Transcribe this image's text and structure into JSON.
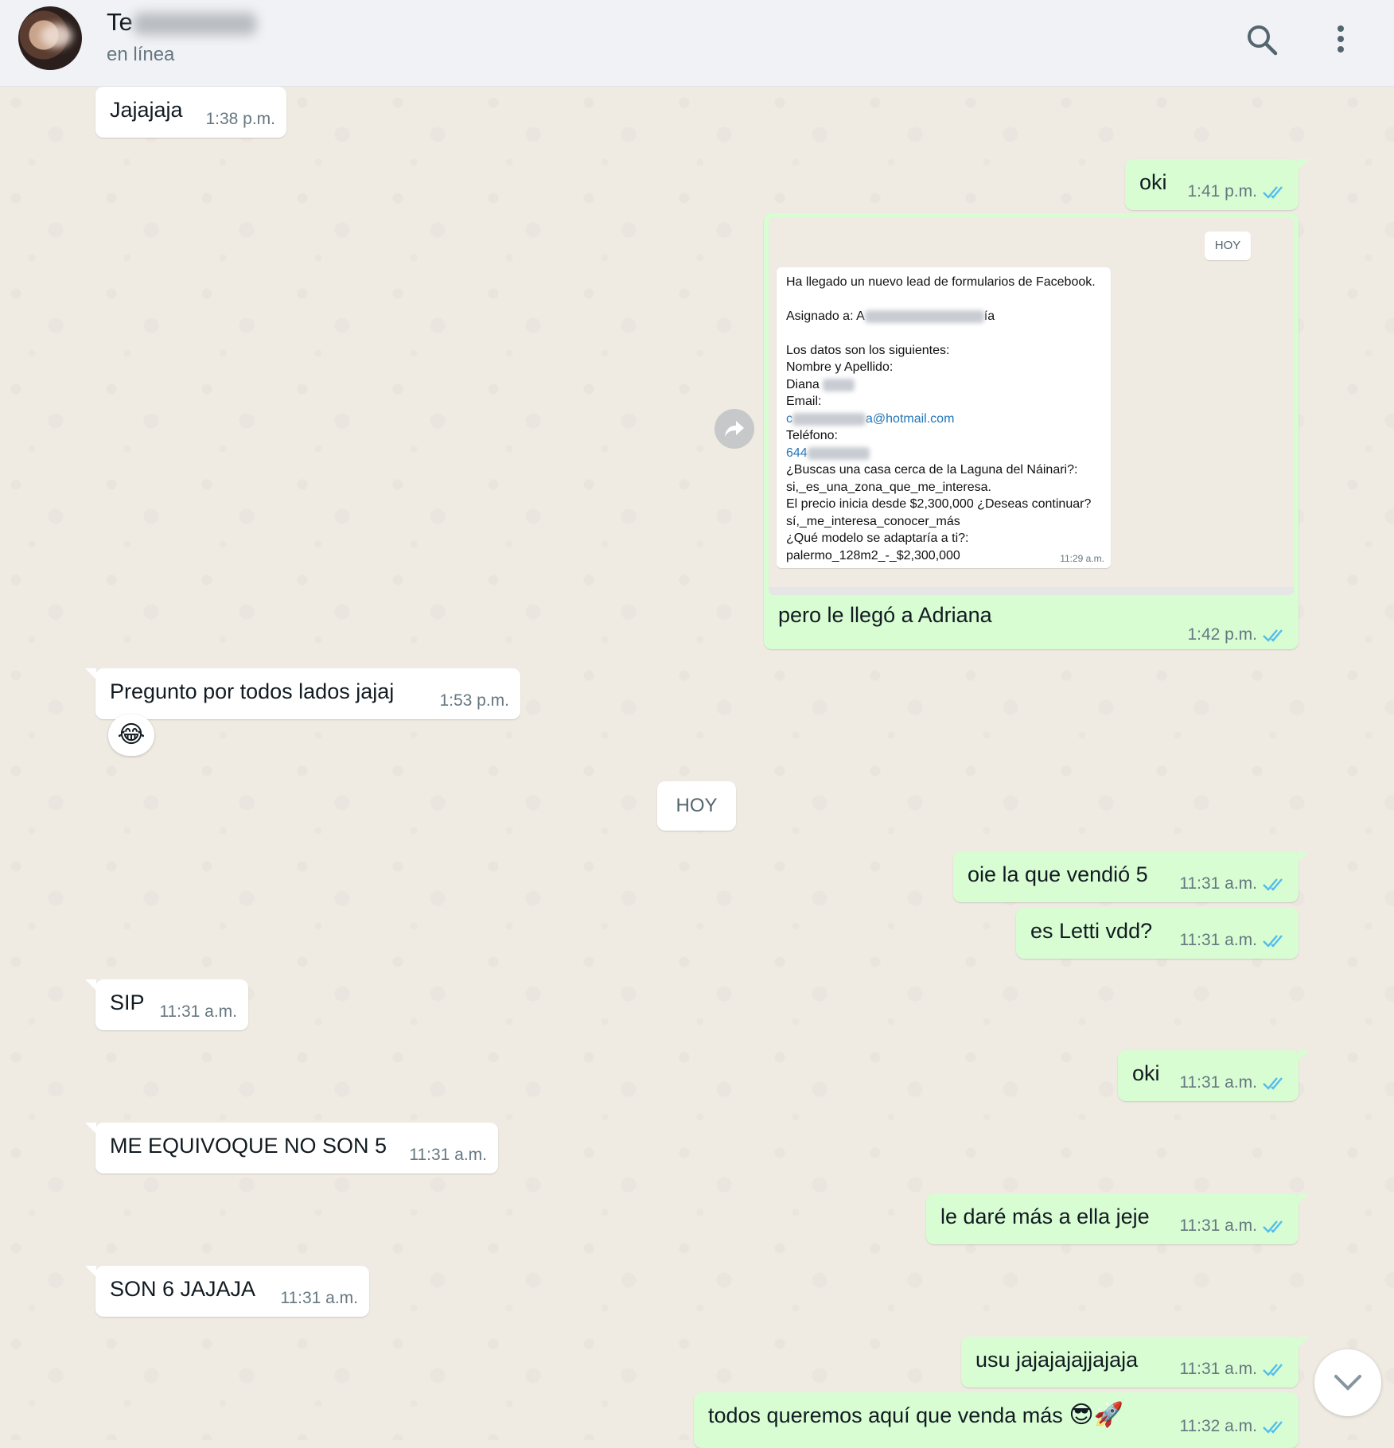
{
  "header": {
    "contact_name": "Te",
    "status": "en línea",
    "icons": [
      "search-icon",
      "more-vert-icon"
    ]
  },
  "colors": {
    "incoming_bubble": "#ffffff",
    "outgoing_bubble": "#d9fdd3",
    "chat_background": "#efeae2",
    "read_ticks": "#53bdeb",
    "header_background": "#f0f2f5"
  },
  "messages": [
    {
      "dir": "in",
      "text": "Jajajaja",
      "time": "1:38 p.m."
    },
    {
      "dir": "out",
      "text": "oki",
      "time": "1:41 p.m."
    },
    {
      "dir": "out",
      "type": "image",
      "caption": "pero le llegó a Adriana",
      "time": "1:42 p.m."
    },
    {
      "dir": "in",
      "text": "Pregunto por todos lados jajaj",
      "time": "1:53 p.m.",
      "reaction": "😂"
    },
    {
      "dir": "out",
      "text": "oie la que vendió 5",
      "time": "11:31 a.m."
    },
    {
      "dir": "out",
      "text": "es Letti vdd?",
      "time": "11:31 a.m."
    },
    {
      "dir": "in",
      "text": "SIP",
      "time": "11:31 a.m."
    },
    {
      "dir": "out",
      "text": "oki",
      "time": "11:31 a.m."
    },
    {
      "dir": "in",
      "text": "ME EQUIVOQUE NO SON 5",
      "time": "11:31 a.m."
    },
    {
      "dir": "out",
      "text": "le daré más a ella jeje",
      "time": "11:31 a.m."
    },
    {
      "dir": "in",
      "text": "SON 6 JAJAJA",
      "time": "11:31 a.m."
    },
    {
      "dir": "out",
      "text": "usu jajajajajjajaja",
      "time": "11:31 a.m."
    },
    {
      "dir": "out",
      "text": "todos queremos aquí que venda más",
      "emoji": "😎🚀",
      "time": "11:32 a.m."
    }
  ],
  "day_separator": "HOY",
  "image_content": {
    "day_label": "HOY",
    "lines": [
      "Ha llegado un nuevo lead de formularios de Facebook.",
      "Asignado a: A",
      "ía",
      "Los datos son los siguientes:",
      "Nombre y Apellido:",
      "Diana",
      "Email:",
      "c",
      "a@hotmail.com",
      "Teléfono:",
      "644",
      "¿Buscas una casa cerca de la Laguna del Náinari?:",
      "si,_es_una_zona_que_me_interesa.",
      "El precio inicia desde $2,300,000 ¿Deseas continuar?",
      "sí,_me_interesa_conocer_más",
      "¿Qué modelo se adaptaría a ti?:",
      "palermo_128m2_-_$2,300,000"
    ],
    "time": "11:29 a.m."
  }
}
